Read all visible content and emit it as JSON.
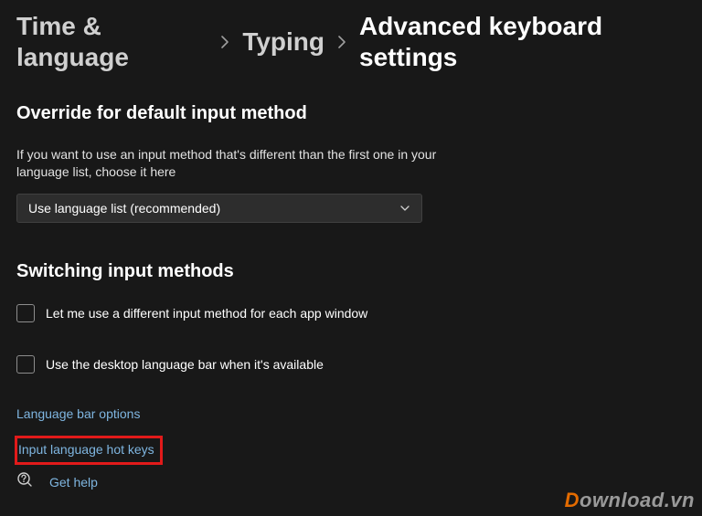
{
  "breadcrumb": {
    "level1": "Time & language",
    "level2": "Typing",
    "current": "Advanced keyboard settings"
  },
  "override": {
    "heading": "Override for default input method",
    "description": "If you want to use an input method that's different than the first one in your language list, choose it here",
    "dropdown_value": "Use language list (recommended)"
  },
  "switching": {
    "heading": "Switching input methods",
    "checkbox1_label": "Let me use a different input method for each app window",
    "checkbox2_label": "Use the desktop language bar when it's available",
    "link_language_bar": "Language bar options",
    "link_hotkeys": "Input language hot keys"
  },
  "help": {
    "label": "Get help"
  },
  "watermark": {
    "d": "D",
    "rest": "ownload.vn"
  }
}
